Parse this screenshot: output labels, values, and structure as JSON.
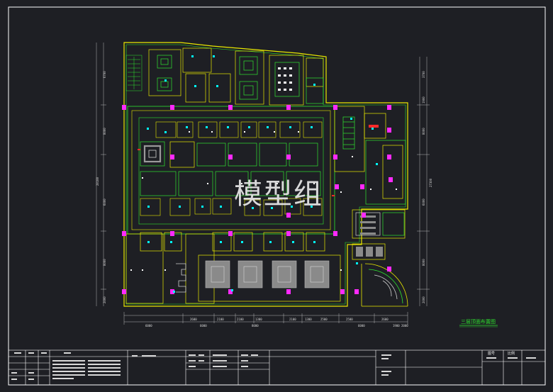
{
  "watermark": "模型组",
  "plan_title": "三层顶面布置图",
  "dims": {
    "top": [
      "2600",
      "2100",
      "2100",
      "1300",
      "2100",
      "1300",
      "2500",
      "2500",
      "2600"
    ],
    "bottom": [
      "6000",
      "6000",
      "8000",
      "6000",
      "1900",
      "2000"
    ],
    "left": [
      "6700",
      "8000",
      "28180",
      "6000",
      "8000",
      "2000"
    ],
    "right": [
      "3700",
      "1900",
      "8000",
      "27300",
      "6000",
      "8000",
      "2000"
    ]
  },
  "title_block": {
    "sheet_label": "图号",
    "scale_label": "比例"
  },
  "colors": {
    "frame": "#ffffff",
    "wall": "#e8e800",
    "green": "#2fe52f",
    "cyan": "#00ffff",
    "magenta": "#ff2aff",
    "bg": "#1e1f24"
  }
}
